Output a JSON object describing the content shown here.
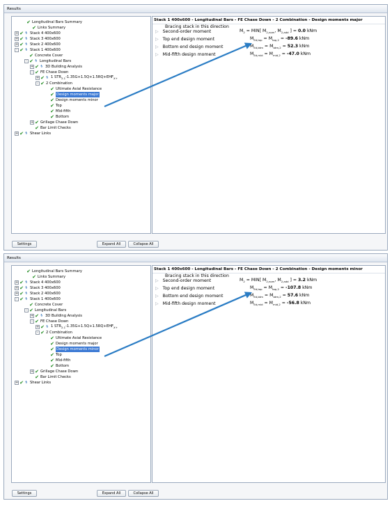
{
  "panels": [
    {
      "title": "Results",
      "tree": [
        {
          "label": "Longitudinal Bars Summary",
          "exp": "",
          "bolt": false
        },
        {
          "label": "Links Summary",
          "exp": "",
          "bolt": false
        },
        {
          "label": "Stack 4 400x600",
          "exp": "+",
          "bolt": true
        },
        {
          "label": "Stack 3 400x600",
          "exp": "+",
          "bolt": true
        },
        {
          "label": "Stack 2 400x600",
          "exp": "+",
          "bolt": true
        },
        {
          "label": "Stack 1 400x600",
          "exp": "-",
          "bolt": true
        },
        {
          "label": "Concrete Cover",
          "exp": "",
          "bolt": false
        },
        {
          "label": "Longitudinal Bars",
          "exp": "-",
          "bolt": true
        },
        {
          "label": "3D Building Analysis",
          "exp": "+",
          "bolt": true
        },
        {
          "label": "FE Chase Down",
          "exp": "-",
          "bolt": false
        },
        {
          "label": "1 STR",
          "exp": "+",
          "bolt": true,
          "sub": "2.1",
          "tail": "-1.35G+1.5Q+1.5RQ+EHF",
          "sub2": "X+"
        },
        {
          "label": "2 Combination",
          "exp": "-",
          "bolt": false
        },
        {
          "label": "Ultimate Axial Resistance",
          "exp": "",
          "bolt": false
        },
        {
          "label": "Design moments major",
          "exp": "",
          "bolt": false
        },
        {
          "label": "Design moments minor",
          "exp": "",
          "bolt": false
        },
        {
          "label": "Top",
          "exp": "",
          "bolt": false
        },
        {
          "label": "Mid-fifth",
          "exp": "",
          "bolt": false
        },
        {
          "label": "Bottom",
          "exp": "",
          "bolt": false
        },
        {
          "label": "Grillage Chase Down",
          "exp": "+",
          "bolt": false
        },
        {
          "label": "Bar Limit Checks",
          "exp": "",
          "bolt": false
        },
        {
          "label": "Shear Links",
          "exp": "+",
          "bolt": true
        }
      ],
      "selected_index": 13,
      "content_title": "Stack 1 400x600 - Longitudinal Bars - FE Chase Down - 2 Combination - Design moments major",
      "bracing": "Bracing stack in this direction",
      "rows": [
        {
          "label": "Second-order moment",
          "lhs": "M",
          "lhs_sub": "2",
          "mid": " = MIN[ M",
          "mid_sub1": "2,nom",
          "mid2": ", M",
          "mid_sub2": "2,add",
          "end": " ] = ",
          "value": "0.0",
          "unit": " kNm"
        },
        {
          "label": "Top end design moment",
          "lhs": "M",
          "lhs_sub": "Ed,top",
          "mid": " = M",
          "mid_sub1": "top,2",
          "mid2": "",
          "mid_sub2": "",
          "end": " = ",
          "value": "-89.6",
          "unit": " kNm"
        },
        {
          "label": "Bottom end design moment",
          "lhs": "M",
          "lhs_sub": "Ed,btm",
          "mid": " = M",
          "mid_sub1": "btm,2",
          "mid2": "",
          "mid_sub2": "",
          "end": " = ",
          "value": "52.3",
          "unit": " kNm"
        },
        {
          "label": "Mid-fifth design moment",
          "lhs": "M",
          "lhs_sub": "Ed,mid",
          "mid": " = M",
          "mid_sub1": "mid,2",
          "mid2": "",
          "mid_sub2": "",
          "end": " = ",
          "value": "-47.0",
          "unit": " kNm"
        }
      ],
      "buttons": {
        "settings": "Settings",
        "expand_all": "Expand All",
        "collapse_all": "Collapse All"
      },
      "accent": "#2a7cc4"
    },
    {
      "title": "Results",
      "tree": [
        {
          "label": "Longitudinal Bars Summary",
          "exp": "",
          "bolt": false
        },
        {
          "label": "Links Summary",
          "exp": "",
          "bolt": false
        },
        {
          "label": "Stack 4 400x600",
          "exp": "+",
          "bolt": true
        },
        {
          "label": "Stack 3 400x600",
          "exp": "+",
          "bolt": true
        },
        {
          "label": "Stack 2 400x600",
          "exp": "+",
          "bolt": true
        },
        {
          "label": "Stack 1 400x600",
          "exp": "-",
          "bolt": true
        },
        {
          "label": "Concrete Cover",
          "exp": "",
          "bolt": false
        },
        {
          "label": "Longitudinal Bars",
          "exp": "-",
          "bolt": false
        },
        {
          "label": "3D Building Analysis",
          "exp": "+",
          "bolt": true
        },
        {
          "label": "FE Chase Down",
          "exp": "-",
          "bolt": false
        },
        {
          "label": "1 STR",
          "exp": "+",
          "bolt": true,
          "sub": "2.1",
          "tail": "-1.35G+1.5Q+1.5RQ+EHF",
          "sub2": "X+"
        },
        {
          "label": "2 Combination",
          "exp": "-",
          "bolt": false
        },
        {
          "label": "Ultimate Axial Resistance",
          "exp": "",
          "bolt": false
        },
        {
          "label": "Design moments major",
          "exp": "",
          "bolt": false
        },
        {
          "label": "Design moments minor",
          "exp": "",
          "bolt": false
        },
        {
          "label": "Top",
          "exp": "",
          "bolt": false
        },
        {
          "label": "Mid-fifth",
          "exp": "",
          "bolt": false
        },
        {
          "label": "Bottom",
          "exp": "",
          "bolt": false
        },
        {
          "label": "Grillage Chase Down",
          "exp": "+",
          "bolt": false
        },
        {
          "label": "Bar Limit Checks",
          "exp": "",
          "bolt": false
        },
        {
          "label": "Shear Links",
          "exp": "+",
          "bolt": true
        }
      ],
      "selected_index": 14,
      "content_title": "Stack 1 400x600 - Longitudinal Bars - FE Chase Down - 2 Combination - Design moments minor",
      "bracing": "Bracing stack in this direction",
      "rows": [
        {
          "label": "Second-order moment",
          "lhs": "M",
          "lhs_sub": "2",
          "mid": " = MIN[ M",
          "mid_sub1": "2,nom",
          "mid2": ", M",
          "mid_sub2": "2,add",
          "end": " ] = ",
          "value": "3.2",
          "unit": " kNm"
        },
        {
          "label": "Top end design moment",
          "lhs": "M",
          "lhs_sub": "Ed,top",
          "mid": " = M",
          "mid_sub1": "top,2",
          "mid2": "",
          "mid_sub2": "",
          "end": " = ",
          "value": "-107.8",
          "unit": " kNm"
        },
        {
          "label": "Bottom end design moment",
          "lhs": "M",
          "lhs_sub": "Ed,btm",
          "mid": " = M",
          "mid_sub1": "btm,2",
          "mid2": "",
          "mid_sub2": "",
          "end": " = ",
          "value": "57.6",
          "unit": " kNm"
        },
        {
          "label": "Mid-fifth design moment",
          "lhs": "M",
          "lhs_sub": "Ed,mid",
          "mid": " = M",
          "mid_sub1": "mid,2",
          "mid2": "",
          "mid_sub2": "",
          "end": " = ",
          "value": "-56.8",
          "unit": " kNm"
        }
      ],
      "buttons": {
        "settings": "Settings",
        "expand_all": "Expand All",
        "collapse_all": "Collapse All"
      },
      "accent": "#2a7cc4"
    }
  ]
}
